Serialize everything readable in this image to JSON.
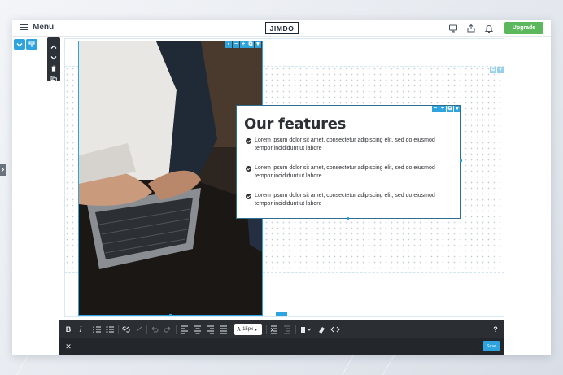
{
  "topbar": {
    "menu_label": "Menu",
    "logo_text": "JIMDO",
    "upgrade_label": "Upgrade"
  },
  "icons": [
    "menu-icon",
    "desktop-icon",
    "share-icon",
    "bell-icon",
    "chevron-down-icon",
    "paint-brush-icon",
    "chevron-up-icon",
    "trash-icon",
    "copy-icon",
    "image-icon",
    "minus-icon",
    "plus-icon",
    "close-icon"
  ],
  "features": {
    "title": "Our features",
    "items": [
      {
        "text": "Lorem ipsum dolor sit amet, consectetur adipiscing elit, sed do eiusmod tempor incididunt ut labore"
      },
      {
        "text": "Lorem ipsum dolor sit amet, consectetur adipiscing elit, sed do eiusmod tempor incididunt ut labore"
      },
      {
        "text": "Lorem ipsum dolor sit amet, consectetur adipiscing elit, sed do eiusmod tempor incididunt ut labore"
      }
    ]
  },
  "editor": {
    "bold": "B",
    "italic": "I",
    "font_size": "15px",
    "help": "?",
    "close": "✕",
    "save_label": "Save"
  },
  "colors": {
    "accent": "#2ea3dd",
    "upgrade": "#5cb85c",
    "toolbar": "#2b2f33"
  }
}
